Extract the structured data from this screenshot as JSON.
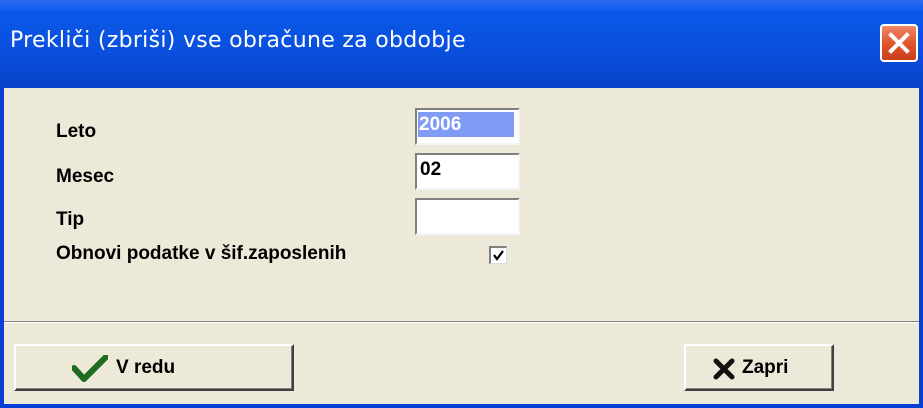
{
  "window": {
    "title": "Prekliči (zbriši) vse obračune za obdobje"
  },
  "form": {
    "year": {
      "label": "Leto",
      "value": "2006"
    },
    "month": {
      "label": "Mesec",
      "value": "02"
    },
    "type": {
      "label": "Tip",
      "value": ""
    },
    "refresh": {
      "label": "Obnovi podatke v šif.zaposlenih",
      "checked": true
    }
  },
  "buttons": {
    "ok": {
      "label": "V redu",
      "icon": "checkmark-icon"
    },
    "close": {
      "label": "Zapri",
      "icon": "x-icon"
    }
  },
  "colors": {
    "title_bar": "#0a4fdd",
    "close_button": "#e0522a",
    "selection": "#7f9bf3",
    "dialog_bg": "#ece9d8",
    "ok_icon": "#1f6b1f"
  }
}
